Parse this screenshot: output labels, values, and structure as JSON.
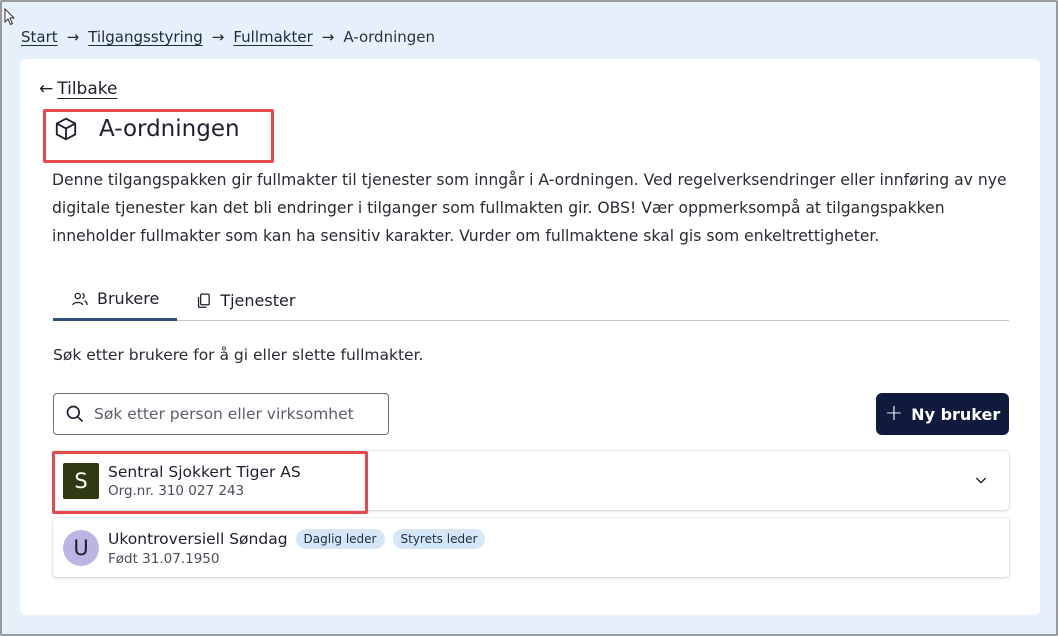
{
  "breadcrumb": {
    "items": [
      "Start",
      "Tilgangsstyring",
      "Fullmakter"
    ],
    "current": "A-ordningen",
    "separator": "→"
  },
  "back": {
    "arrow": "←",
    "label": "Tilbake"
  },
  "title": "A-ordningen",
  "title_icon": "cube-icon",
  "description": "Denne tilgangspakken gir fullmakter til tjenester som inngår i A-ordningen. Ved regelverksendringer eller innføring av nye digitale tjenester kan det bli endringer i tilganger som fullmakten gir. OBS! Vær oppmerksompå at tilgangspakken inneholder fullmakter som kan ha sensitiv karakter. Vurder om fullmaktene skal gis som enkeltrettigheter.",
  "tabs": [
    {
      "label": "Brukere",
      "icon": "users-icon",
      "active": true
    },
    {
      "label": "Tjenester",
      "icon": "files-icon",
      "active": false
    }
  ],
  "hint": "Søk etter brukere for å gi eller slette fullmakter.",
  "search": {
    "placeholder": "Søk etter person eller virksomhet",
    "value": ""
  },
  "new_user_button": {
    "label": "Ny bruker",
    "icon": "+"
  },
  "entries": [
    {
      "initial": "S",
      "name": "Sentral Sjokkert Tiger AS",
      "sub": "Org.nr. 310 027 243",
      "badges": [],
      "avatar_color": "#2f3a13"
    },
    {
      "initial": "U",
      "name": "Ukontroversiell Søndag",
      "sub": "Født 31.07.1950",
      "badges": [
        "Daglig leder",
        "Styrets leder"
      ],
      "avatar_color": "#bcb4e3"
    }
  ],
  "colors": {
    "background": "#e6f0fa",
    "primary_button": "#0f1a3d",
    "highlight_box": "#e5484d",
    "badge": "#d5e6f6"
  }
}
